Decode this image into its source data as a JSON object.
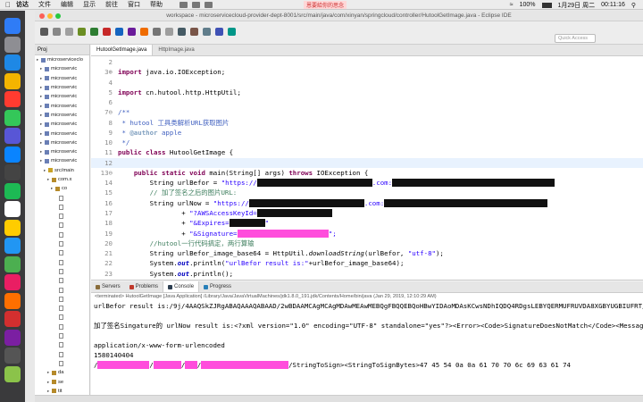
{
  "menubar": {
    "items": [
      "访达",
      "文件",
      "编辑",
      "显示",
      "前往",
      "窗口",
      "帮助"
    ],
    "center_label": "恩要給你的思念",
    "right": {
      "battery": "100%",
      "date_time": "1月29日 周二",
      "clock": "00:11:16"
    }
  },
  "window": {
    "title": "workspace - microservicecloud-provider-dept-8001/src/main/java/com/xinyan/springcloud/controller/HutoolGetImage.java - Eclipse IDE",
    "quick_access_placeholder": "Quick Access"
  },
  "package_explorer": {
    "tab_label": "Proj",
    "rows": [
      {
        "label": "microserviceclo",
        "indent": 0,
        "kind": "project"
      },
      {
        "label": "microservic",
        "indent": 1,
        "kind": "project"
      },
      {
        "label": "microservic",
        "indent": 1,
        "kind": "project"
      },
      {
        "label": "microservic",
        "indent": 1,
        "kind": "project"
      },
      {
        "label": "microservic",
        "indent": 1,
        "kind": "project"
      },
      {
        "label": "microservic",
        "indent": 1,
        "kind": "project"
      },
      {
        "label": "microservic",
        "indent": 1,
        "kind": "project"
      },
      {
        "label": "microservic",
        "indent": 1,
        "kind": "project"
      },
      {
        "label": "microservic",
        "indent": 1,
        "kind": "project"
      },
      {
        "label": "microservic",
        "indent": 1,
        "kind": "project"
      },
      {
        "label": "microservic",
        "indent": 1,
        "kind": "project"
      },
      {
        "label": "microservic",
        "indent": 1,
        "kind": "project"
      },
      {
        "label": "src/main",
        "indent": 2,
        "kind": "folder"
      },
      {
        "label": "com.x",
        "indent": 3,
        "kind": "package"
      },
      {
        "label": "co",
        "indent": 4,
        "kind": "package"
      },
      {
        "label": "",
        "indent": 5,
        "kind": "file"
      },
      {
        "label": "",
        "indent": 5,
        "kind": "file"
      },
      {
        "label": "",
        "indent": 5,
        "kind": "file"
      },
      {
        "label": "",
        "indent": 5,
        "kind": "file"
      },
      {
        "label": "",
        "indent": 5,
        "kind": "file"
      },
      {
        "label": "",
        "indent": 5,
        "kind": "file"
      },
      {
        "label": "",
        "indent": 5,
        "kind": "file"
      },
      {
        "label": "",
        "indent": 5,
        "kind": "file"
      },
      {
        "label": "",
        "indent": 5,
        "kind": "file"
      },
      {
        "label": "",
        "indent": 5,
        "kind": "file"
      },
      {
        "label": "",
        "indent": 5,
        "kind": "file"
      },
      {
        "label": "",
        "indent": 5,
        "kind": "file"
      },
      {
        "label": "",
        "indent": 5,
        "kind": "file"
      },
      {
        "label": "",
        "indent": 5,
        "kind": "file"
      },
      {
        "label": "",
        "indent": 5,
        "kind": "file"
      },
      {
        "label": "",
        "indent": 5,
        "kind": "file"
      },
      {
        "label": "",
        "indent": 5,
        "kind": "file"
      },
      {
        "label": "",
        "indent": 5,
        "kind": "file"
      },
      {
        "label": "",
        "indent": 5,
        "kind": "file"
      },
      {
        "label": "da",
        "indent": 3,
        "kind": "package"
      },
      {
        "label": "se",
        "indent": 3,
        "kind": "package"
      },
      {
        "label": "tit",
        "indent": 3,
        "kind": "package"
      },
      {
        "label": "lpr",
        "indent": 3,
        "kind": "package"
      },
      {
        "label": "src/main",
        "indent": 2,
        "kind": "folder"
      }
    ]
  },
  "editor": {
    "tabs": [
      {
        "label": "HutoolGetImage.java",
        "active": true
      },
      {
        "label": "HttpImage.java",
        "active": false
      }
    ],
    "lines": [
      {
        "no": "2",
        "parts": [
          {
            "t": "",
            "c": ""
          }
        ]
      },
      {
        "no": "3⊕",
        "parts": [
          {
            "t": "import",
            "c": "kw"
          },
          {
            "t": " java.io.IOException;",
            "c": ""
          }
        ]
      },
      {
        "no": "4",
        "parts": [
          {
            "t": "",
            "c": ""
          }
        ]
      },
      {
        "no": "5",
        "parts": [
          {
            "t": "import",
            "c": "kw"
          },
          {
            "t": " cn.hutool.http.HttpUtil;",
            "c": ""
          }
        ]
      },
      {
        "no": "6",
        "parts": [
          {
            "t": "",
            "c": ""
          }
        ]
      },
      {
        "no": "7⊖",
        "parts": [
          {
            "t": "/**",
            "c": "jd"
          }
        ]
      },
      {
        "no": "8",
        "parts": [
          {
            "t": " * ",
            "c": "jd"
          },
          {
            "t": "hutool",
            "c": "jd"
          },
          {
            "t": " 工具类解析URL获取图片",
            "c": "jd"
          }
        ]
      },
      {
        "no": "9",
        "parts": [
          {
            "t": " * ",
            "c": "jd"
          },
          {
            "t": "@author",
            "c": "jdt"
          },
          {
            "t": " apple",
            "c": "jd"
          }
        ]
      },
      {
        "no": "10",
        "parts": [
          {
            "t": " */",
            "c": "jd"
          }
        ]
      },
      {
        "no": "11",
        "parts": [
          {
            "t": "public class",
            "c": "kw"
          },
          {
            "t": " HutoolGetImage {",
            "c": ""
          }
        ]
      },
      {
        "no": "12",
        "parts": [
          {
            "t": "",
            "c": ""
          }
        ],
        "hl": true
      },
      {
        "no": "13⊖",
        "parts": [
          {
            "t": "    ",
            "c": ""
          },
          {
            "t": "public static void",
            "c": "kw"
          },
          {
            "t": " main(String[] args) ",
            "c": ""
          },
          {
            "t": "throws",
            "c": "kw"
          },
          {
            "t": " IOException {",
            "c": ""
          }
        ]
      },
      {
        "no": "14",
        "parts": [
          {
            "t": "        String urlBefor = ",
            "c": ""
          },
          {
            "t": "\"https://",
            "c": "str"
          },
          {
            "t": "xxxxxxxxxxxxxxxxxxxxxxxxxxxxx",
            "c": "redact"
          },
          {
            "t": ".com:",
            "c": "str"
          },
          {
            "t": "xxxxxxxxxxxxxxxxxxxxxxxxxxxxxxxxxxxxxxxxx",
            "c": "redact"
          }
        ]
      },
      {
        "no": "15",
        "parts": [
          {
            "t": "        // 加了签名之后的图片URL:",
            "c": "cm"
          }
        ]
      },
      {
        "no": "16",
        "parts": [
          {
            "t": "        String urlNow = ",
            "c": ""
          },
          {
            "t": "\"https://",
            "c": "str"
          },
          {
            "t": "xxxxxxxxxxxxxxxxxxxxxxxxxxxxx",
            "c": "redact"
          },
          {
            "t": ".com:",
            "c": "str"
          },
          {
            "t": "xxxxxxxxxxxxxxxxxxxxxxxxxxxxxxxxxxxxxxxxx",
            "c": "redact"
          }
        ]
      },
      {
        "no": "17",
        "parts": [
          {
            "t": "                + ",
            "c": ""
          },
          {
            "t": "\"?AWSAccessKeyId=",
            "c": "str"
          },
          {
            "t": "xxxxxxxxxxxxxxxxxxx",
            "c": "redact"
          }
        ]
      },
      {
        "no": "18",
        "parts": [
          {
            "t": "                + ",
            "c": ""
          },
          {
            "t": "\"&Expires=",
            "c": "str"
          },
          {
            "t": "xxxxxxxxx",
            "c": "redact"
          },
          {
            "t": "\"",
            "c": "str"
          }
        ]
      },
      {
        "no": "19",
        "parts": [
          {
            "t": "                + ",
            "c": ""
          },
          {
            "t": "\"&Signature=",
            "c": "str"
          },
          {
            "t": "xxxxxxxxxxxxxxxxxxxxxxx",
            "c": "redact2"
          },
          {
            "t": "\";",
            "c": "str"
          }
        ]
      },
      {
        "no": "20",
        "parts": [
          {
            "t": "        //hutool一行代码搞定，两行算输",
            "c": "cm"
          }
        ]
      },
      {
        "no": "21",
        "parts": [
          {
            "t": "        String urlBefor_image_base64 = HttpUtil.",
            "c": ""
          },
          {
            "t": "downloadString",
            "c": "it"
          },
          {
            "t": "(urlBefor, ",
            "c": ""
          },
          {
            "t": "\"utf-8\"",
            "c": "str"
          },
          {
            "t": ");",
            "c": ""
          }
        ]
      },
      {
        "no": "22",
        "parts": [
          {
            "t": "        System.",
            "c": ""
          },
          {
            "t": "out",
            "c": "fld"
          },
          {
            "t": ".println(",
            "c": ""
          },
          {
            "t": "\"urlBefor result is:\"",
            "c": "str"
          },
          {
            "t": "+urlBefor_image_base64);",
            "c": ""
          }
        ]
      },
      {
        "no": "23",
        "parts": [
          {
            "t": "        System.",
            "c": ""
          },
          {
            "t": "out",
            "c": "fld"
          },
          {
            "t": ".println();",
            "c": ""
          }
        ]
      },
      {
        "no": "24",
        "parts": [
          {
            "t": "        String urlNow_image_base64 = HttpUtil.",
            "c": ""
          },
          {
            "t": "downloadString",
            "c": "it"
          },
          {
            "t": "(urlNow, ",
            "c": ""
          },
          {
            "t": "\"utf-8\"",
            "c": "str"
          },
          {
            "t": ");",
            "c": ""
          }
        ]
      },
      {
        "no": "25",
        "parts": [
          {
            "t": "        System.",
            "c": ""
          },
          {
            "t": "out",
            "c": "fld"
          },
          {
            "t": ".println(",
            "c": ""
          },
          {
            "t": "\"加了签名Singature的 urlNow result is:\"",
            "c": "str"
          },
          {
            "t": "+urlNow_image_base64);",
            "c": ""
          }
        ]
      },
      {
        "no": "26",
        "parts": [
          {
            "t": "    }",
            "c": ""
          }
        ]
      }
    ]
  },
  "console": {
    "tabs": [
      {
        "label": "Servers",
        "active": false,
        "color": "#8a6d3b"
      },
      {
        "label": "Problems",
        "active": false,
        "color": "#c0392b"
      },
      {
        "label": "Console",
        "active": true,
        "color": "#2c3e50"
      },
      {
        "label": "Progress",
        "active": false,
        "color": "#2980b9"
      }
    ],
    "terminated": "<terminated> HutoolGetImage [Java Application] /Library/Java/JavaVirtualMachines/jdk1.8.0_191.jdk/Contents/Home/bin/java (Jan 29, 2019, 12:10:29 AM)",
    "lines": [
      {
        "parts": [
          {
            "t": "urlBefor result is:/9j/4AAQSkZJRgABAQAAAQABAAD/2wBDAAMCAgMCAgMDAwMEAwMEBQgFBQQEBQoHBwYIDAoMDAsKCwsNDhIQDQ4RDgsLEBYQERMUFRUVDA8XGBYUGBIUFRT/",
            "c": ""
          }
        ]
      },
      {
        "parts": [
          {
            "t": "",
            "c": ""
          }
        ]
      },
      {
        "parts": [
          {
            "t": "加了签名Singature的 urlNow result is:<?xml version=\"1.0\" encoding=\"UTF-8\" standalone=\"yes\"?><Error><Code>SignatureDoesNotMatch</Code><Message>",
            "c": ""
          }
        ]
      },
      {
        "parts": [
          {
            "t": "",
            "c": ""
          }
        ]
      },
      {
        "parts": [
          {
            "t": "application/x-www-form-urlencoded",
            "c": ""
          }
        ]
      },
      {
        "parts": [
          {
            "t": "1580140404",
            "c": ""
          }
        ]
      },
      {
        "parts": [
          {
            "t": "/",
            "c": ""
          },
          {
            "t": "xxxxxxxxxxxxx",
            "c": "redact2"
          },
          {
            "t": "/",
            "c": ""
          },
          {
            "t": "xxxxxxx",
            "c": "redact2"
          },
          {
            "t": "/",
            "c": ""
          },
          {
            "t": "xxx",
            "c": "redact2"
          },
          {
            "t": "/",
            "c": ""
          },
          {
            "t": "xxxxxxxxxxxxxxxxxxxxxx",
            "c": "redact2"
          },
          {
            "t": "/StringToSign><StringToSignBytes>47 45 54 0a 0a 61 70 70 6c 69 63 61 74",
            "c": ""
          }
        ]
      }
    ]
  },
  "colors": {
    "keyword": "#7f0055",
    "string": "#2a00ff",
    "comment": "#3f7f5f",
    "javadoc": "#3f5fbf",
    "highlight": "#e8f2fe"
  },
  "icons": {
    "apple": "apple-logo-icon",
    "battery": "battery-icon",
    "wifi": "wifi-icon",
    "search": "search-icon"
  }
}
